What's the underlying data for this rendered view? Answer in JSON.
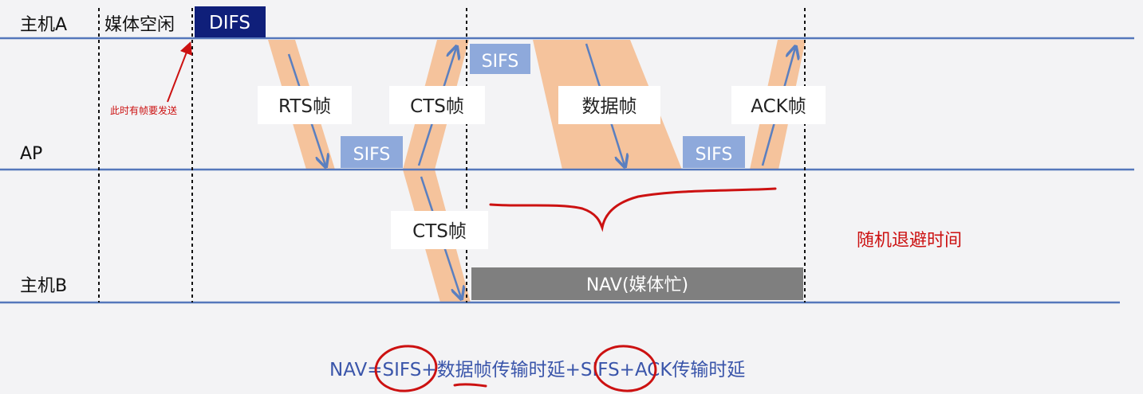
{
  "nodes": {
    "host_a": "主机A",
    "ap": "AP",
    "host_b": "主机B"
  },
  "labels": {
    "idle": "媒体空闲",
    "difs": "DIFS",
    "frame_ready": "此时有帧要发送",
    "rts": "RTS帧",
    "cts_top": "CTS帧",
    "cts_bottom": "CTS帧",
    "data": "数据帧",
    "ack": "ACK帧",
    "sifs_1": "SIFS",
    "sifs_2": "SIFS",
    "sifs_3": "SIFS",
    "nav": "NAV(媒体忙)",
    "backoff": "随机退避时间"
  },
  "formula": {
    "p1": "NAV=",
    "p2": "SIFS",
    "p3": "+",
    "p4": "数据帧传输时延",
    "p5": "+",
    "p6": "SIFS",
    "p7": "+ACK传输时延"
  },
  "colors": {
    "background": "#f3f3f5",
    "timeline": "#5577bb",
    "frame_band": "#f5c39c",
    "arrow": "#5a7fc0",
    "sifs_box": "#8ea9db",
    "difs_box": "#0f1f7a",
    "nav_box": "#7f7f7f",
    "annotation_red": "#cc1111",
    "formula_text": "#3a55aa"
  }
}
